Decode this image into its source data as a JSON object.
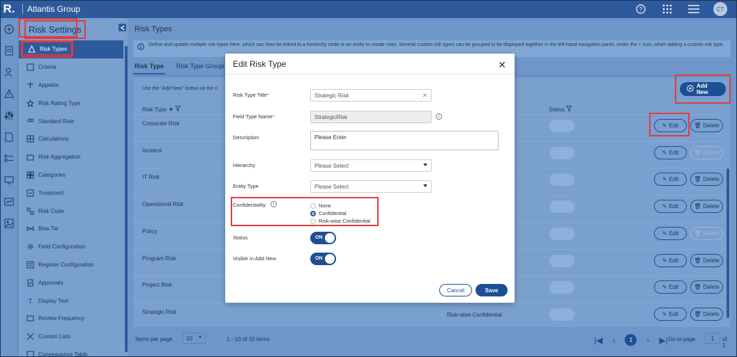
{
  "app": {
    "logo": "R.",
    "name": "Atlantis Group",
    "user_initials": "CT"
  },
  "sidebar": {
    "title": "Risk Settings",
    "items": [
      {
        "label": "Risk Types",
        "icon": "risk-types-icon"
      },
      {
        "label": "Criteria",
        "icon": "criteria-icon"
      },
      {
        "label": "Appetite",
        "icon": "appetite-icon"
      },
      {
        "label": "Risk Rating Type",
        "icon": "star-icon"
      },
      {
        "label": "Standard Role",
        "icon": "users-icon"
      },
      {
        "label": "Calculations",
        "icon": "calculator-icon"
      },
      {
        "label": "Risk Aggregation",
        "icon": "aggregation-icon"
      },
      {
        "label": "Categories",
        "icon": "categories-icon"
      },
      {
        "label": "Treatment",
        "icon": "treatment-icon"
      },
      {
        "label": "Risk Code",
        "icon": "code-icon"
      },
      {
        "label": "Bow Tie",
        "icon": "bowtie-icon"
      },
      {
        "label": "Field Configuration",
        "icon": "gear-icon"
      },
      {
        "label": "Register Configuration",
        "icon": "register-icon"
      },
      {
        "label": "Approvals",
        "icon": "approvals-icon"
      },
      {
        "label": "Display Text",
        "icon": "display-text-icon"
      },
      {
        "label": "Review Frequency",
        "icon": "review-icon"
      },
      {
        "label": "Custom Lists",
        "icon": "custom-lists-icon"
      },
      {
        "label": "Consequence Table",
        "icon": "table-icon"
      }
    ]
  },
  "main": {
    "title": "Risk Types",
    "info": "Define and update multiple risk types here, which can then be linked to a hierarchy node or an entity to create risks. Several custom risk types can be grouped to be displayed together in the left-hand navigation panel, under the + icon, when adding a custom risk type.",
    "tabs": [
      {
        "label": "Risk Type"
      },
      {
        "label": "Risk Type Groupi"
      }
    ],
    "hint": "Use the \"Add New\" button on the ri",
    "add_new": "Add New",
    "columns": {
      "risk_type": "Risk Type",
      "status": "Status"
    },
    "rows": [
      {
        "name": "Corporate Risk",
        "confidentiality": "",
        "delete_enabled": true
      },
      {
        "name": "Incident",
        "confidentiality": "",
        "delete_enabled": false
      },
      {
        "name": "IT Risk",
        "confidentiality": "",
        "delete_enabled": true
      },
      {
        "name": "Operational Risk",
        "confidentiality": "",
        "delete_enabled": true
      },
      {
        "name": "Policy",
        "confidentiality": "",
        "delete_enabled": false
      },
      {
        "name": "Program Risk",
        "confidentiality": "",
        "delete_enabled": true
      },
      {
        "name": "Project Risk",
        "confidentiality": "",
        "delete_enabled": true
      },
      {
        "name": "Strategic Risk",
        "confidentiality": "Risk-wise Confidential",
        "delete_enabled": true
      }
    ],
    "edit_label": "Edit",
    "delete_label": "Delete",
    "pager": {
      "items_per_page_label": "Items per page",
      "items_per_page": "10",
      "range": "1 - 10 of 10 items",
      "page": "1",
      "goto_label": "Go to page",
      "goto_value": "1",
      "of": "of 1"
    }
  },
  "modal": {
    "title": "Edit Risk Type",
    "fields": {
      "risk_type_title_label": "Risk Type Title",
      "risk_type_title": "Strategic Risk",
      "field_type_name_label": "Field Type Name",
      "field_type_name": "StrategicRisk",
      "description_label": "Description",
      "description": "Please Enter",
      "hierarchy_label": "Hierarchy",
      "hierarchy": "Please Select",
      "entity_type_label": "Entity Type",
      "entity_type": "Please Select",
      "confidentiality_label": "Confidentiality",
      "confidentiality_options": [
        "None",
        "Confidential",
        "Risk-wise Confidential"
      ],
      "confidentiality_selected": "Confidential",
      "status_label": "Status",
      "status": "ON",
      "visible_label": "Visible in Add New",
      "visible": "ON"
    },
    "cancel": "Cancel",
    "save": "Save",
    "required_mark": "*"
  },
  "colors": {
    "header": "#2d5a9c",
    "accent": "#1d4f94",
    "highlight": "#e23b3b"
  }
}
